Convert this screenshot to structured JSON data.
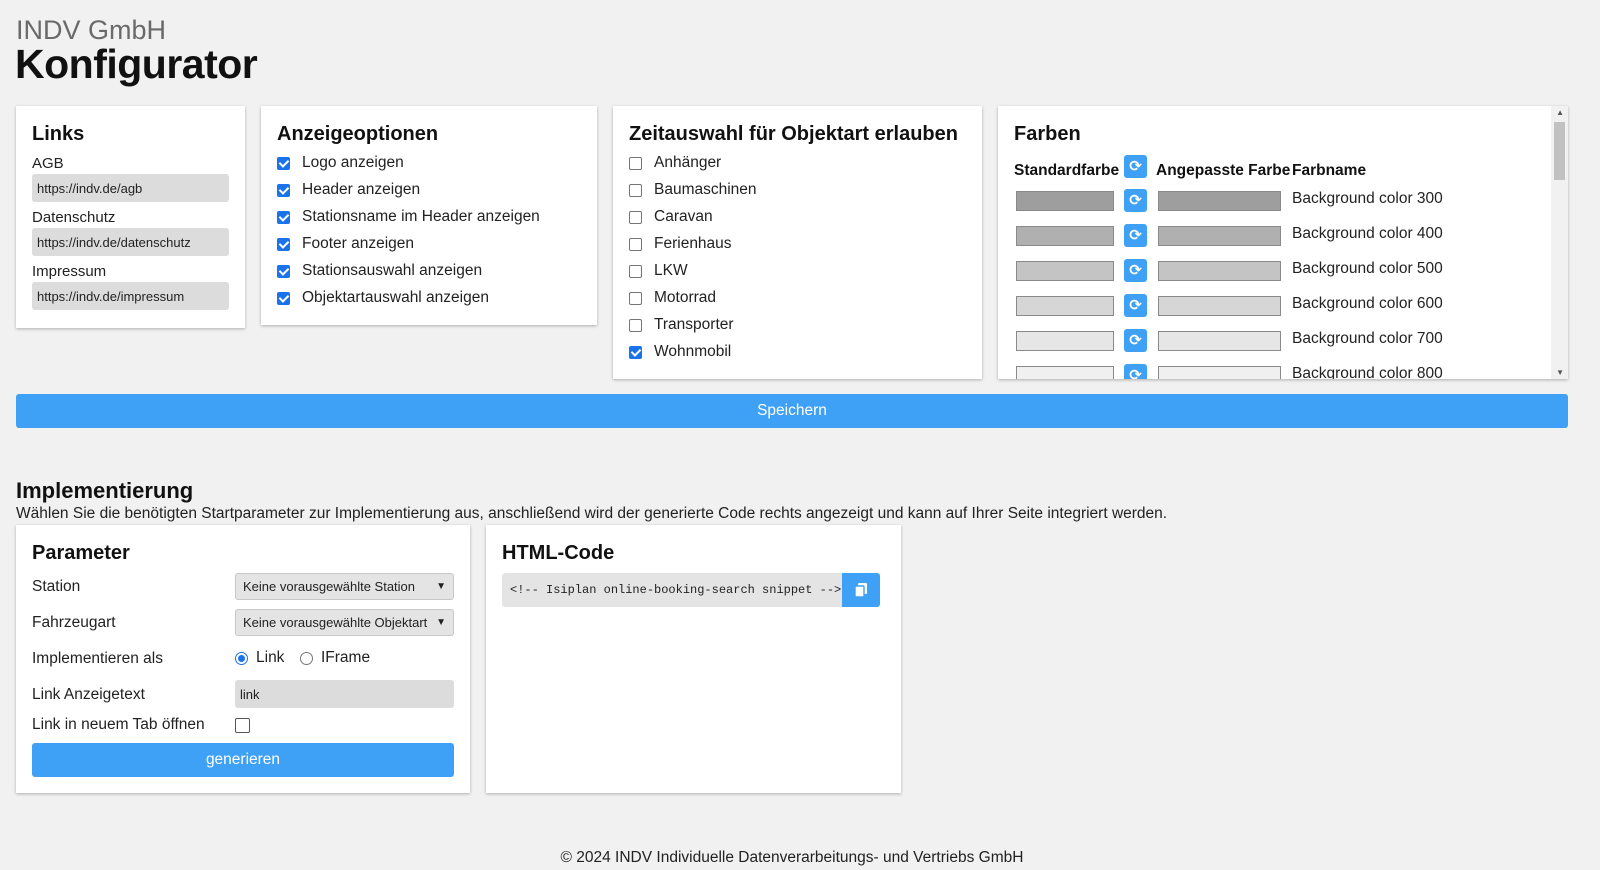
{
  "header": {
    "company": "INDV GmbH",
    "title": "Konfigurator"
  },
  "links_card": {
    "title": "Links",
    "fields": [
      {
        "label": "AGB",
        "value": "https://indv.de/agb"
      },
      {
        "label": "Datenschutz",
        "value": "https://indv.de/datenschutz"
      },
      {
        "label": "Impressum",
        "value": "https://indv.de/impressum"
      }
    ]
  },
  "anzeige_card": {
    "title": "Anzeigeoptionen",
    "options": [
      {
        "label": "Logo anzeigen",
        "checked": true
      },
      {
        "label": "Header anzeigen",
        "checked": true
      },
      {
        "label": "Stationsname im Header anzeigen",
        "checked": true
      },
      {
        "label": "Footer anzeigen",
        "checked": true
      },
      {
        "label": "Stationsauswahl anzeigen",
        "checked": true
      },
      {
        "label": "Objektartauswahl anzeigen",
        "checked": true
      }
    ]
  },
  "zeit_card": {
    "title": "Zeitauswahl für Objektart erlauben",
    "options": [
      {
        "label": "Anhänger",
        "checked": false
      },
      {
        "label": "Baumaschinen",
        "checked": false
      },
      {
        "label": "Caravan",
        "checked": false
      },
      {
        "label": "Ferienhaus",
        "checked": false
      },
      {
        "label": "LKW",
        "checked": false
      },
      {
        "label": "Motorrad",
        "checked": false
      },
      {
        "label": "Transporter",
        "checked": false
      },
      {
        "label": "Wohnmobil",
        "checked": true
      }
    ]
  },
  "farben_card": {
    "title": "Farben",
    "col_default": "Standardfarbe",
    "col_custom": "Angepasste Farbe",
    "col_name": "Farbname",
    "rows": [
      {
        "name": "Background color 300",
        "default_color": "#9e9e9e",
        "custom_color": "#9e9e9e"
      },
      {
        "name": "Background color 400",
        "default_color": "#b0b0b0",
        "custom_color": "#b0b0b0"
      },
      {
        "name": "Background color 500",
        "default_color": "#c4c4c4",
        "custom_color": "#c4c4c4"
      },
      {
        "name": "Background color 600",
        "default_color": "#d6d6d6",
        "custom_color": "#d6d6d6"
      },
      {
        "name": "Background color 700",
        "default_color": "#e6e6e6",
        "custom_color": "#e6e6e6"
      },
      {
        "name": "Background color 800",
        "default_color": "#f0f0f0",
        "custom_color": "#f0f0f0"
      }
    ]
  },
  "save_label": "Speichern",
  "implementation": {
    "title": "Implementierung",
    "description": "Wählen Sie die benötigten Startparameter zur Implementierung aus, anschließend wird der generierte Code rechts angezeigt und kann auf Ihrer Seite integriert werden."
  },
  "param_card": {
    "title": "Parameter",
    "station_label": "Station",
    "station_value": "Keine vorausgewählte Station",
    "fahrzeug_label": "Fahrzeugart",
    "fahrzeug_value": "Keine vorausgewählte Objektart",
    "impl_label": "Implementieren als",
    "radio_link": "Link",
    "radio_iframe": "IFrame",
    "link_text_label": "Link Anzeigetext",
    "link_text_value": "link",
    "new_tab_label": "Link in neuem Tab öffnen",
    "generate_label": "generieren"
  },
  "html_card": {
    "title": "HTML-Code",
    "code": "<!-- Isiplan online-booking-search snippet -->"
  },
  "footer": "© 2024 INDV Individuelle Datenverarbeitungs- und Vertriebs GmbH",
  "colors": {
    "accent": "#3fa1f5",
    "checkbox": "#1a73e8"
  }
}
